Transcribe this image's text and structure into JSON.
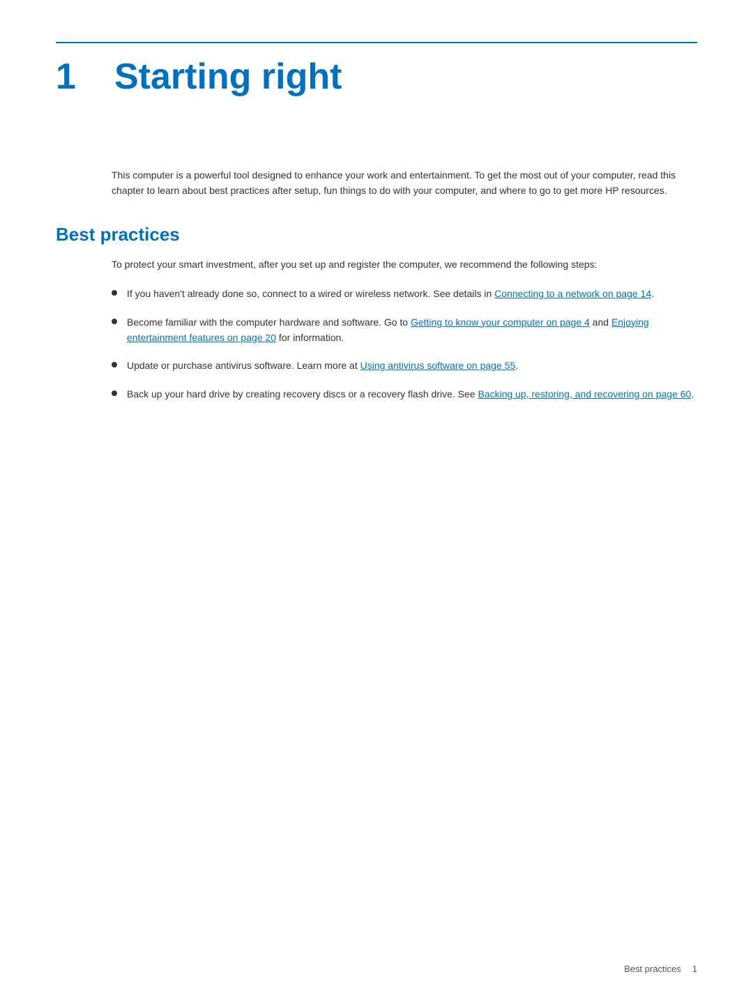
{
  "page": {
    "background": "#ffffff"
  },
  "header": {
    "chapter_number": "1",
    "chapter_title": "Starting right"
  },
  "intro": {
    "text": "This computer is a powerful tool designed to enhance your work and entertainment. To get the most out of your computer, read this chapter to learn about best practices after setup, fun things to do with your computer, and where to go to get more HP resources."
  },
  "best_practices": {
    "section_title": "Best practices",
    "section_intro": "To protect your smart investment, after you set up and register the computer, we recommend the following steps:",
    "bullet_items": [
      {
        "id": "bullet1",
        "text_before": "If you haven’t already done so, connect to a wired or wireless network. See details in ",
        "link1_text": "Connecting to a network on page 14",
        "link1_href": "#",
        "text_after": ".",
        "text_between": "",
        "link2_text": "",
        "link2_href": "",
        "text_end": ""
      },
      {
        "id": "bullet2",
        "text_before": "Become familiar with the computer hardware and software. Go to ",
        "link1_text": "Getting to know your computer on page 4",
        "link1_href": "#",
        "text_between": " and ",
        "link2_text": "Enjoying entertainment features on page 20",
        "link2_href": "#",
        "text_after": " for information.",
        "text_end": ""
      },
      {
        "id": "bullet3",
        "text_before": "Update or purchase antivirus software. Learn more at ",
        "link1_text": "Using antivirus software on page 55",
        "link1_href": "#",
        "text_between": "",
        "link2_text": "",
        "link2_href": "",
        "text_after": ".",
        "text_end": ""
      },
      {
        "id": "bullet4",
        "text_before": "Back up your hard drive by creating recovery discs or a recovery flash drive. See ",
        "link1_text": "Backing up, restoring, and recovering on page 60",
        "link1_href": "#",
        "text_between": "",
        "link2_text": "",
        "link2_href": "",
        "text_after": ".",
        "text_end": ""
      }
    ]
  },
  "footer": {
    "section_label": "Best practices",
    "page_number": "1"
  }
}
